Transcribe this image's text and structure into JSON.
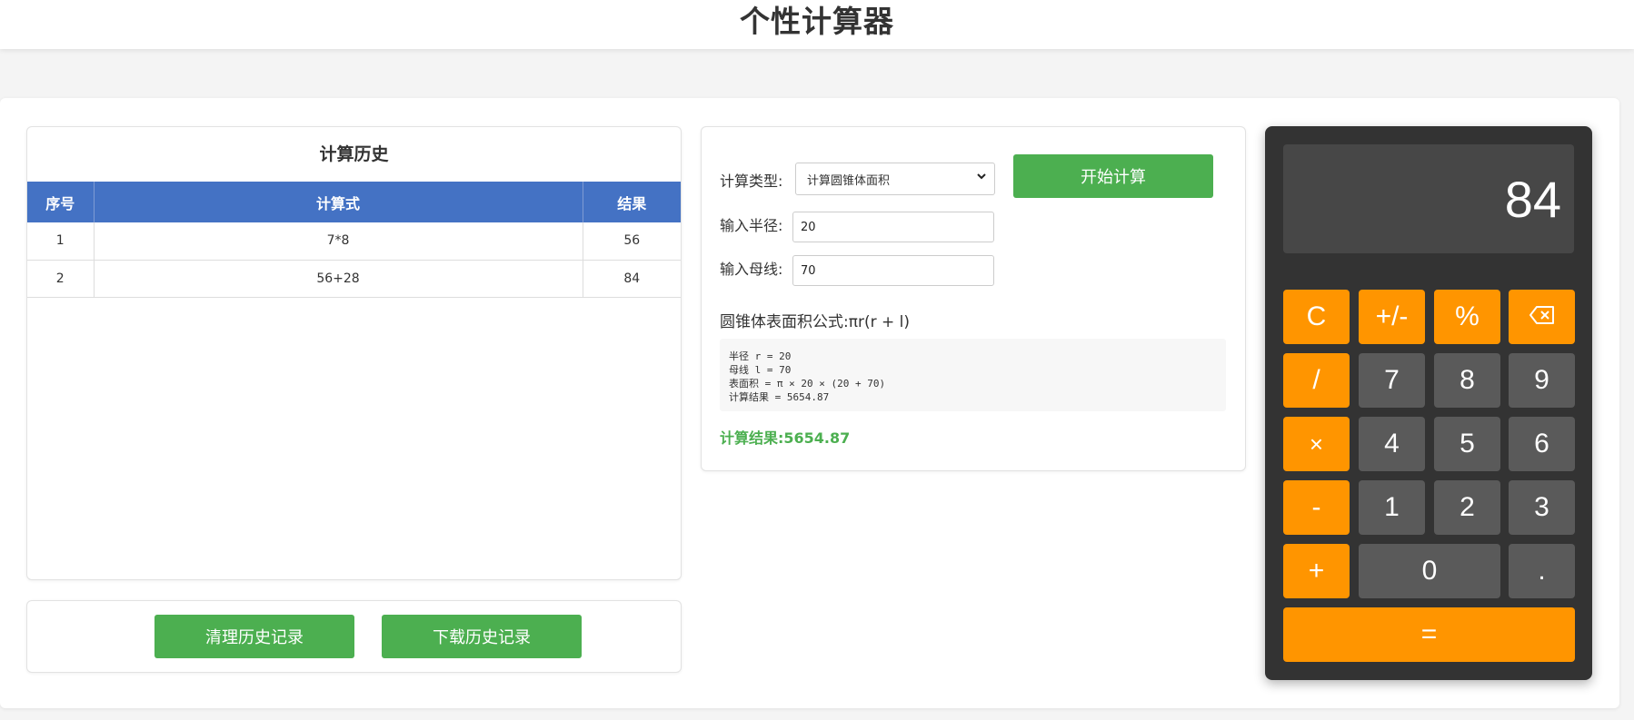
{
  "app": {
    "title": "个性计算器"
  },
  "history": {
    "title": "计算历史",
    "columns": [
      "序号",
      "计算式",
      "结果"
    ],
    "rows": [
      {
        "index": "1",
        "expr": "7*8",
        "result": "56"
      },
      {
        "index": "2",
        "expr": "56+28",
        "result": "84"
      }
    ],
    "clear_label": "清理历史记录",
    "download_label": "下载历史记录"
  },
  "geometry": {
    "type_label": "计算类型:",
    "type_selected": "计算圆锥体面积",
    "radius_label": "输入半径:",
    "radius_value": "20",
    "slant_label": "输入母线:",
    "slant_value": "70",
    "start_label": "开始计算",
    "formula": "圆锥体表面积公式:πr(r + l)",
    "detail_lines": [
      "半径 r = 20",
      "母线 l = 70",
      "表面积 = π × 20 × (20 + 70)",
      "计算结果 = 5654.87"
    ],
    "result": "计算结果:5654.87"
  },
  "calculator": {
    "display": "84",
    "keys": [
      "C",
      "+/-",
      "%",
      "⌫",
      "/",
      "7",
      "8",
      "9",
      "×",
      "4",
      "5",
      "6",
      "-",
      "1",
      "2",
      "3",
      "+",
      "0",
      ".",
      "="
    ]
  },
  "colors": {
    "accent_green": "#4caf50",
    "table_header": "#4472c4",
    "calc_orange": "#ff9500",
    "calc_body": "#333333"
  }
}
